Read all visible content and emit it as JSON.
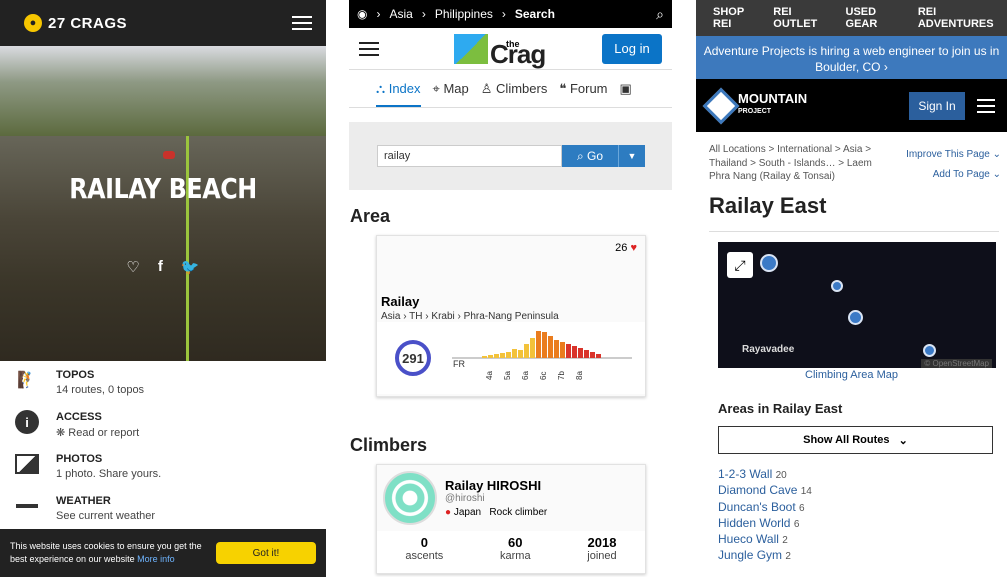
{
  "crags27": {
    "brand": "27 CRAGS",
    "hero_title": "RAILAY BEACH",
    "rows": [
      {
        "title": "TOPOS",
        "sub": "14 routes, 0 topos",
        "icon": "climber-icon"
      },
      {
        "title": "ACCESS",
        "sub": "❋ Read or report",
        "icon": "info-icon"
      },
      {
        "title": "PHOTOS",
        "sub": "1 photo. Share yours.",
        "icon": "image-icon"
      },
      {
        "title": "WEATHER",
        "sub": "See current weather",
        "icon": "weather-icon"
      }
    ],
    "cookie_text": "This website uses cookies to ensure you get the best experience on our website",
    "cookie_more": "More info",
    "cookie_button": "Got it!"
  },
  "thecrag": {
    "breadcrumb": [
      "Asia",
      "Philippines",
      "Search"
    ],
    "logo_small": "the",
    "logo_word": "Crag",
    "login": "Log in",
    "nav": [
      "Index",
      "Map",
      "Climbers",
      "Forum"
    ],
    "search_value": "railay",
    "go_label": "Go",
    "area_heading": "Area",
    "area": {
      "likes": "26",
      "name": "Railay",
      "path": [
        "Asia",
        "TH",
        "Krabi",
        "Phra-Nang Peninsula"
      ],
      "routes": "291",
      "grade_system": "FR",
      "grades": [
        "4a",
        "5a",
        "6a",
        "6c",
        "7b",
        "8a"
      ]
    },
    "climbers_heading": "Climbers",
    "climber": {
      "name": "Railay HIROSHI",
      "handle": "@hiroshi",
      "country": "Japan",
      "role": "Rock climber",
      "stats": [
        {
          "value": "0",
          "label": "ascents"
        },
        {
          "value": "60",
          "label": "karma"
        },
        {
          "value": "2018",
          "label": "joined"
        }
      ]
    }
  },
  "mp": {
    "top_links": [
      "SHOP REI",
      "REI OUTLET",
      "USED GEAR",
      "REI ADVENTURES"
    ],
    "banner": "Adventure Projects is hiring a web engineer to join us in Boulder, CO ›",
    "brand_top": "MOUNTAIN",
    "brand_bottom": "PROJECT",
    "sign_in": "Sign In",
    "breadcrumb": "All Locations > International > Asia > Thailand > South - Islands… > Laem Phra Nang (Railay & Tonsai)",
    "improve": "Improve This Page",
    "add": "Add To Page",
    "title": "Railay East",
    "map_label": "Rayavadee",
    "map_attr": "© OpenStreetMap",
    "map_link": "Climbing Area Map",
    "areas_heading": "Areas in Railay East",
    "show_all": "Show All Routes",
    "areas": [
      {
        "name": "1-2-3 Wall",
        "count": "20"
      },
      {
        "name": "Diamond Cave",
        "count": "14"
      },
      {
        "name": "Duncan's Boot",
        "count": "6"
      },
      {
        "name": "Hidden World",
        "count": "6"
      },
      {
        "name": "Hueco Wall",
        "count": "2"
      },
      {
        "name": "Jungle Gym",
        "count": "2"
      }
    ]
  }
}
